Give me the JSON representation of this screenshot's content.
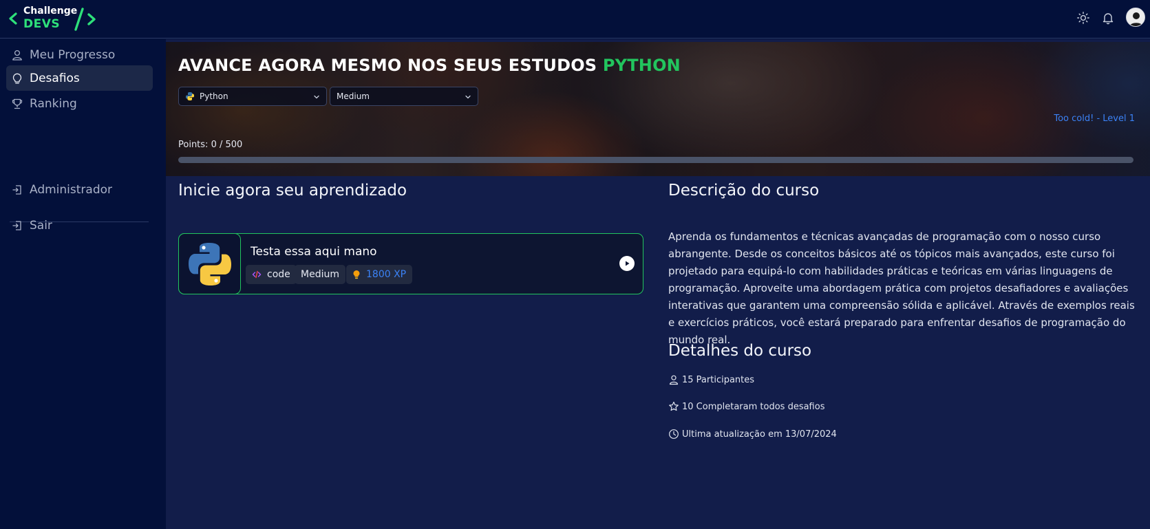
{
  "app": {
    "brand_top": "Challenge",
    "brand_bottom": "DEVS",
    "colors": {
      "accent": "#22c55e",
      "link": "#3b82f6",
      "bg": "#03103a",
      "main_bg": "#121d4a"
    }
  },
  "header": {
    "icons": [
      "sun-icon",
      "bell-icon"
    ]
  },
  "sidebar": {
    "items": [
      {
        "label": "Meu Progresso",
        "icon": "user-icon"
      },
      {
        "label": "Desafios",
        "icon": "lightbulb-icon",
        "active": true
      },
      {
        "label": "Ranking",
        "icon": "trophy-icon"
      },
      {
        "label": "Administrador",
        "icon": "login-icon"
      },
      {
        "label": "Sair",
        "icon": "logout-icon"
      }
    ]
  },
  "hero": {
    "title_prefix": "AVANCE AGORA MESMO NOS SEUS ESTUDOS",
    "title_lang": "PYTHON",
    "language_select": "Python",
    "difficulty_select": "Medium",
    "level_text": "Too cold! - Level 1",
    "points_text": "Points: 0 / 500",
    "progress_fraction": 0
  },
  "challenges": {
    "section_title": "Inicie agora seu aprendizado",
    "items": [
      {
        "title": "Testa essa aqui mano",
        "type_tag": "code",
        "difficulty_tag": "Medium",
        "xp_tag": "1800 XP"
      }
    ]
  },
  "course": {
    "description_title": "Descrição do curso",
    "description": "Aprenda os fundamentos e técnicas avançadas de programação com o nosso curso abrangente. Desde os conceitos básicos até os tópicos mais avançados, este curso foi projetado para equipá-lo com habilidades práticas e teóricas em várias linguagens de programação. Aproveite uma abordagem prática com projetos desafiadores e avaliações interativas que garantem uma compreensão sólida e aplicável. Através de exemplos reais e exercícios práticos, você estará preparado para enfrentar desafios de programação do mundo real.",
    "details_title": "Detalhes do curso",
    "details": {
      "participants": "15 Participantes",
      "completed": "10 Completaram todos desafios",
      "updated": "Ultima atualização em 13/07/2024"
    }
  }
}
